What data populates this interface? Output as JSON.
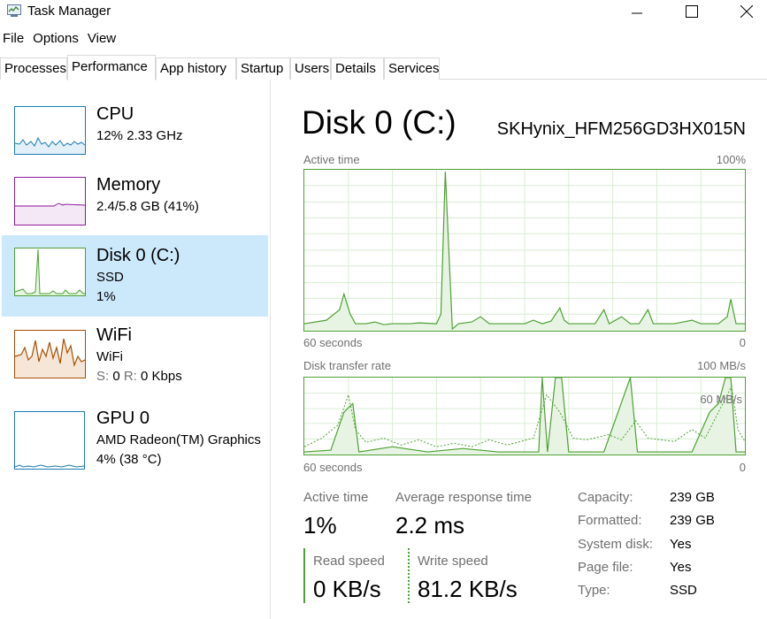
{
  "window": {
    "title": "Task Manager",
    "icon": "task-manager-icon"
  },
  "menu": [
    "File",
    "Options",
    "View"
  ],
  "tabs": [
    "Processes",
    "Performance",
    "App history",
    "Startup",
    "Users",
    "Details",
    "Services"
  ],
  "active_tab": "Performance",
  "devices": [
    {
      "name": "CPU",
      "line1": "12%  2.33 GHz",
      "color": "#1a7ab4"
    },
    {
      "name": "Memory",
      "line1": "2.4/5.8 GB (41%)",
      "color": "#8b1a9b"
    },
    {
      "name": "Disk 0 (C:)",
      "line1": "SSD",
      "line2": "1%",
      "color": "#4da033",
      "selected": true
    },
    {
      "name": "WiFi",
      "line1": "WiFi",
      "line2_label_s": "S:",
      "line2_value_s": "0",
      "line2_label_r": "R:",
      "line2_value_r": "0 Kbps",
      "color": "#a74f01"
    },
    {
      "name": "GPU 0",
      "line1": "AMD Radeon(TM) Graphics",
      "line2": "4% (38 °C)",
      "color": "#1a7ab4"
    }
  ],
  "detail": {
    "title": "Disk 0 (C:)",
    "model": "SKHynix_HFM256GD3HX015N",
    "graph1": {
      "label": "Active time",
      "max": "100%",
      "time": "60 seconds",
      "min": "0"
    },
    "graph2": {
      "label": "Disk transfer rate",
      "max": "100 MB/s",
      "inner": "60 MB/s",
      "time": "60 seconds",
      "min": "0"
    },
    "stats": {
      "active_time_label": "Active time",
      "active_time_value": "1%",
      "avg_response_label": "Average response time",
      "avg_response_value": "2.2 ms",
      "read_label": "Read speed",
      "read_value": "0 KB/s",
      "write_label": "Write speed",
      "write_value": "81.2 KB/s"
    },
    "properties": [
      {
        "label": "Capacity:",
        "value": "239 GB"
      },
      {
        "label": "Formatted:",
        "value": "239 GB"
      },
      {
        "label": "System disk:",
        "value": "Yes"
      },
      {
        "label": "Page file:",
        "value": "Yes"
      },
      {
        "label": "Type:",
        "value": "SSD"
      }
    ]
  }
}
